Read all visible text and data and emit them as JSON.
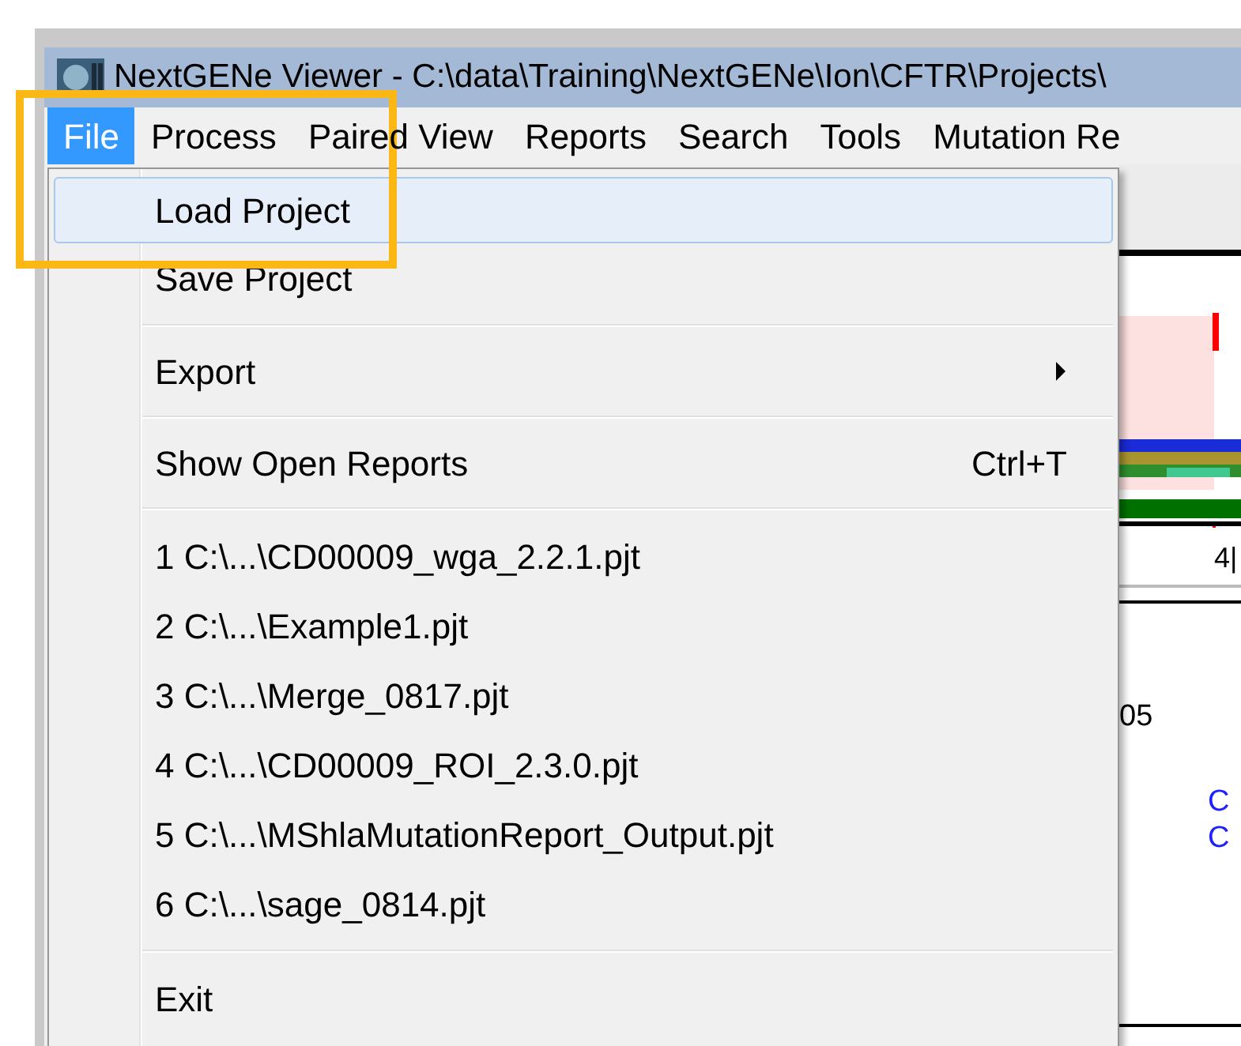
{
  "window": {
    "title": "NextGENe Viewer - C:\\data\\Training\\NextGENe\\Ion\\CFTR\\Projects\\"
  },
  "menu_bar": [
    {
      "label": "File",
      "selected": true
    },
    {
      "label": "Process",
      "selected": false
    },
    {
      "label": "Paired View",
      "selected": false
    },
    {
      "label": "Reports",
      "selected": false
    },
    {
      "label": "Search",
      "selected": false
    },
    {
      "label": "Tools",
      "selected": false
    },
    {
      "label": "Mutation Re",
      "selected": false
    }
  ],
  "file_menu": [
    {
      "kind": "item",
      "label": "Load Project",
      "selected": true
    },
    {
      "kind": "item",
      "label": "Save Project",
      "selected": false
    },
    {
      "kind": "separator"
    },
    {
      "kind": "submenu",
      "label": "Export",
      "selected": false
    },
    {
      "kind": "separator"
    },
    {
      "kind": "item",
      "label": "Show Open Reports",
      "shortcut": "Ctrl+T",
      "selected": false
    },
    {
      "kind": "separator"
    },
    {
      "kind": "recent",
      "label": "1 C:\\...\\CD00009_wga_2.2.1.pjt",
      "selected": false
    },
    {
      "kind": "recent",
      "label": "2 C:\\...\\Example1.pjt",
      "selected": false
    },
    {
      "kind": "recent",
      "label": "3 C:\\...\\Merge_0817.pjt",
      "selected": false
    },
    {
      "kind": "recent",
      "label": "4 C:\\...\\CD00009_ROI_2.3.0.pjt",
      "selected": false
    },
    {
      "kind": "recent",
      "label": "5 C:\\...\\MShlaMutationReport_Output.pjt",
      "selected": false
    },
    {
      "kind": "recent",
      "label": "6 C:\\...\\sage_0814.pjt",
      "selected": false
    },
    {
      "kind": "separator"
    },
    {
      "kind": "item",
      "label": "Exit",
      "selected": false
    }
  ],
  "viewer": {
    "axis_label": "4|",
    "position_text": "05",
    "bases": [
      "C",
      "C"
    ]
  }
}
